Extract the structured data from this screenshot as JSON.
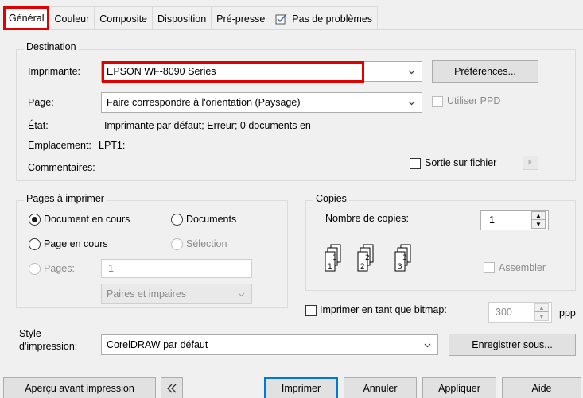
{
  "tabs": [
    {
      "label": "Général",
      "active": true
    },
    {
      "label": "Couleur"
    },
    {
      "label": "Composite"
    },
    {
      "label": "Disposition"
    },
    {
      "label": "Pré-presse"
    },
    {
      "label": "Pas de problèmes",
      "icon": "checklist-icon"
    }
  ],
  "destination": {
    "legend": "Destination",
    "printer_label": "Imprimante:",
    "printer_value": "EPSON WF-8090 Series",
    "preferences_button": "Préférences...",
    "page_label": "Page:",
    "page_value": "Faire correspondre à l'orientation (Paysage)",
    "use_ppd_label": "Utiliser PPD",
    "state_label": "État:",
    "state_value": "Imprimante par défaut; Erreur; 0 documents en",
    "location_label": "Emplacement:",
    "location_value": "LPT1:",
    "comments_label": "Commentaires:",
    "output_file_label": "Sortie sur fichier"
  },
  "pages": {
    "legend": "Pages à imprimer",
    "current_document": "Document en cours",
    "documents": "Documents",
    "current_page": "Page en cours",
    "selection": "Sélection",
    "pages_label": "Pages:",
    "pages_value": "1",
    "parity_value": "Paires et impaires"
  },
  "copies": {
    "legend": "Copies",
    "count_label": "Nombre de copies:",
    "count_value": "1",
    "collate_label": "Assembler"
  },
  "bitmap": {
    "label": "Imprimer en tant que bitmap:",
    "value": "300",
    "unit": "ppp"
  },
  "style": {
    "label_line1": "Style",
    "label_line2": "d'impression:",
    "value": "CorelDRAW par défaut",
    "save_as_button": "Enregistrer sous..."
  },
  "footer": {
    "preview_button": "Aperçu avant impression",
    "print_button": "Imprimer",
    "cancel_button": "Annuler",
    "apply_button": "Appliquer",
    "help_button": "Aide"
  },
  "colors": {
    "highlight": "#e00000",
    "default_button_border": "#0078d7"
  }
}
